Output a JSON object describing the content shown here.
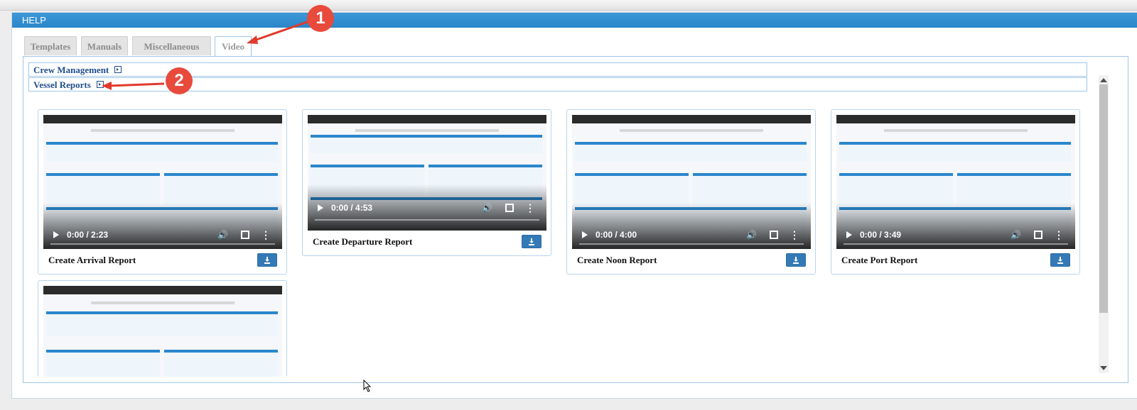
{
  "panel": {
    "title": "HELP"
  },
  "tabs": [
    {
      "label": "Templates",
      "active": false
    },
    {
      "label": "Manuals",
      "active": false
    },
    {
      "label": "Miscellaneous",
      "active": false
    },
    {
      "label": "Video",
      "active": true
    }
  ],
  "accordion": [
    {
      "label": "Crew Management"
    },
    {
      "label": "Vessel Reports"
    }
  ],
  "videos": [
    {
      "title": "Create Arrival Report",
      "time": "0:00 / 2:23"
    },
    {
      "title": "Create Departure Report",
      "time": "0:00 / 4:53"
    },
    {
      "title": "Create Noon Report",
      "time": "0:00 / 4:00"
    },
    {
      "title": "Create Port Report",
      "time": "0:00 / 3:49"
    },
    {
      "title": "",
      "time": ""
    }
  ],
  "annotations": [
    {
      "label": "1"
    },
    {
      "label": "2"
    }
  ],
  "colors": {
    "header_blue": "#2b86c8",
    "link_blue": "#1f4e8c",
    "annotation_red": "#e84a3c",
    "button_blue": "#337ab7"
  }
}
